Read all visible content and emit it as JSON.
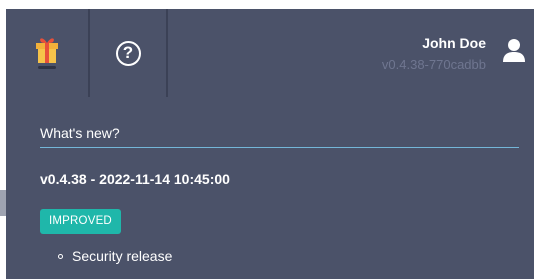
{
  "header": {
    "gift_icon": "gift-icon",
    "help_icon": "question-circle-icon",
    "help_glyph": "?",
    "user": {
      "name": "John Doe",
      "version": "v0.4.38-770cadbb",
      "icon": "user-icon"
    }
  },
  "whats_new": {
    "title": "What's new?",
    "release": {
      "heading": "v0.4.38 - 2022-11-14 10:45:00",
      "badge": "IMPROVED",
      "items": [
        "Security release"
      ]
    }
  },
  "colors": {
    "panel_bg": "#4b5269",
    "badge_bg": "#1fb7aa",
    "title_underline": "#74b6d8",
    "version_text": "#6f7690"
  }
}
